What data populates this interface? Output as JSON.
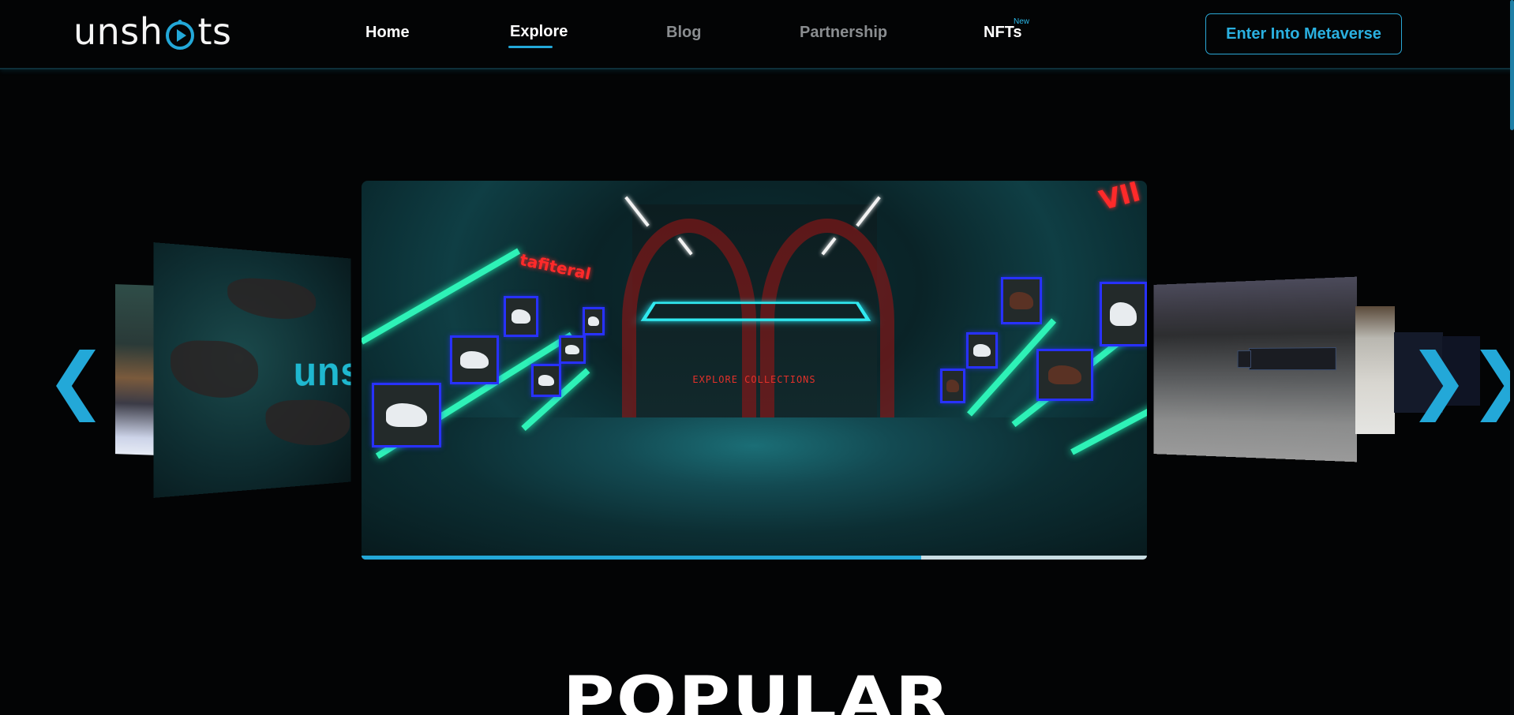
{
  "brand": {
    "name_prefix": "unsh",
    "name_suffix": "ts",
    "accent_color": "#23a8d8"
  },
  "nav": {
    "items": [
      {
        "label": "Home",
        "state": "normal"
      },
      {
        "label": "Explore",
        "state": "active"
      },
      {
        "label": "Blog",
        "state": "dim"
      },
      {
        "label": "Partnership",
        "state": "dim"
      },
      {
        "label": "NFTs",
        "state": "normal",
        "badge": "New"
      }
    ],
    "cta_label": "Enter Into Metaverse"
  },
  "carousel": {
    "prev_icon": "double-chevron-left-icon",
    "next_icon": "double-chevron-right-icon",
    "prev_glyph": "❮❮",
    "next_glyph": "❯❯",
    "left_card_text": "uns",
    "main_card": {
      "center_text": "EXPLORE COLLECTIONS",
      "left_sign": "tafiteral",
      "right_sign": "VII"
    },
    "progress": 0.713
  },
  "section": {
    "title": "POPULAR"
  }
}
